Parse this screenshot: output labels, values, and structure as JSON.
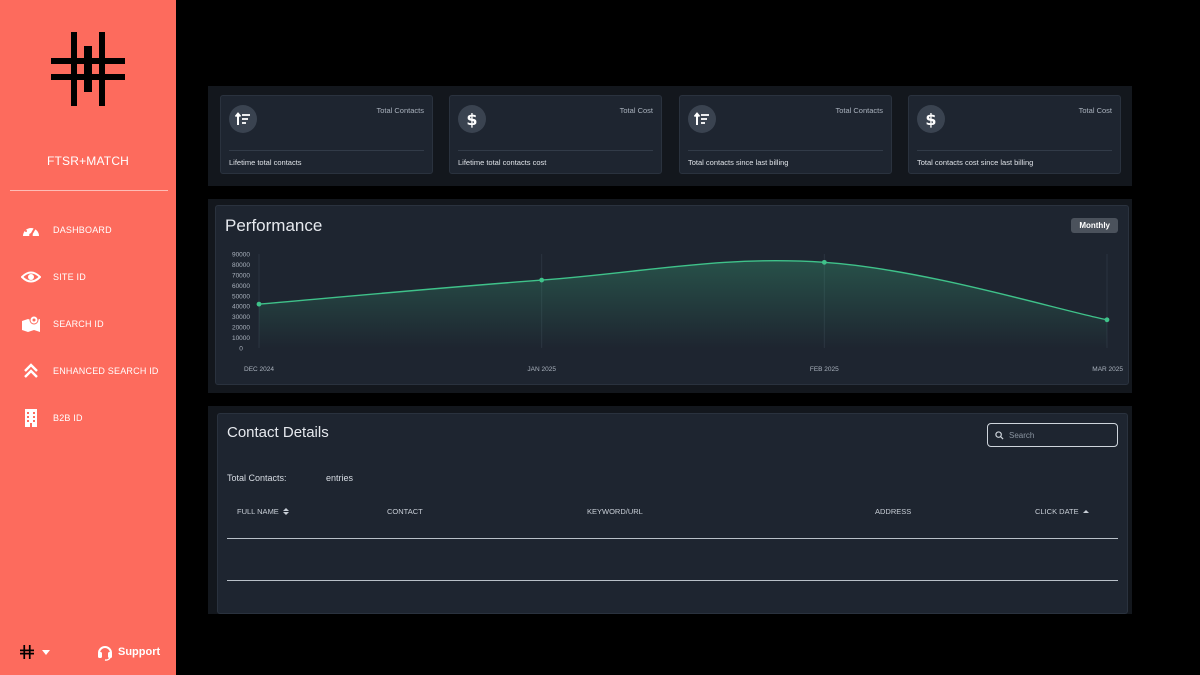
{
  "sidebar": {
    "brand": "FTSR+MATCH",
    "items": [
      {
        "label": "DASHBOARD",
        "icon": "speedometer-icon"
      },
      {
        "label": "SITE ID",
        "icon": "eye-icon"
      },
      {
        "label": "SEARCH ID",
        "icon": "map-icon"
      },
      {
        "label": "ENHANCED SEARCH ID",
        "icon": "double-chevron-up-icon"
      },
      {
        "label": "B2B ID",
        "icon": "building-icon"
      }
    ],
    "support_label": "Support"
  },
  "stats": [
    {
      "title": "Total Contacts",
      "desc": "Lifetime total contacts",
      "icon": "sort-arrows-icon"
    },
    {
      "title": "Total Cost",
      "desc": "Lifetime total contacts cost",
      "icon": "dollar-icon"
    },
    {
      "title": "Total Contacts",
      "desc": "Total contacts since last billing",
      "icon": "sort-arrows-icon"
    },
    {
      "title": "Total Cost",
      "desc": "Total contacts cost since last billing",
      "icon": "dollar-icon"
    }
  ],
  "performance": {
    "title": "Performance",
    "period_button": "Monthly"
  },
  "chart_data": {
    "type": "area",
    "title": "Performance",
    "categories": [
      "DEC 2024",
      "JAN 2025",
      "FEB 2025",
      "MAR 2025"
    ],
    "yticks": [
      0,
      10000,
      20000,
      30000,
      40000,
      50000,
      60000,
      70000,
      80000,
      90000
    ],
    "ylim": [
      0,
      90000
    ],
    "series": [
      {
        "values": [
          42000,
          65000,
          82000,
          27000
        ],
        "color": "#3fc28a"
      }
    ],
    "grid": true
  },
  "contacts": {
    "title": "Contact Details",
    "search_placeholder": "Search",
    "total_label": "Total Contacts:",
    "entries_label": "entries",
    "columns": [
      "FULL NAME",
      "CONTACT",
      "KEYWORD/URL",
      "ADDRESS",
      "CLICK DATE"
    ]
  }
}
